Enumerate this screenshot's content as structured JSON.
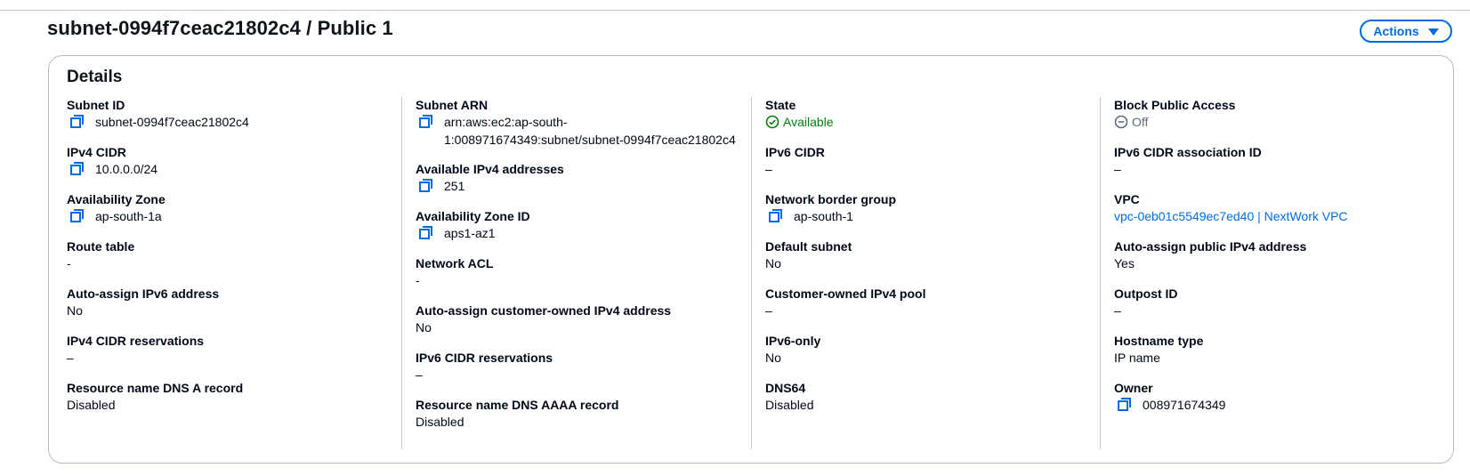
{
  "header": {
    "title": "subnet-0994f7ceac21802c4 / Public 1",
    "actions_label": "Actions"
  },
  "details": {
    "title": "Details",
    "columns": [
      [
        {
          "label": "Subnet ID",
          "value": "subnet-0994f7ceac21802c4",
          "copy": true
        },
        {
          "label": "IPv4 CIDR",
          "value": "10.0.0.0/24",
          "copy": true
        },
        {
          "label": "Availability Zone",
          "value": "ap-south-1a",
          "copy": true
        },
        {
          "label": "Route table",
          "value": "-"
        },
        {
          "label": "Auto-assign IPv6 address",
          "value": "No"
        },
        {
          "label": "IPv4 CIDR reservations",
          "value": "–"
        },
        {
          "label": "Resource name DNS A record",
          "value": "Disabled"
        }
      ],
      [
        {
          "label": "Subnet ARN",
          "value": "arn:aws:ec2:ap-south-\n1:008971674349:subnet/subnet-0994f7ceac21802c4",
          "copy": true
        },
        {
          "label": "Available IPv4 addresses",
          "value": "251",
          "copy": true
        },
        {
          "label": "Availability Zone ID",
          "value": "aps1-az1",
          "copy": true
        },
        {
          "label": "Network ACL",
          "value": "-"
        },
        {
          "label": "Auto-assign customer-owned IPv4 address",
          "value": "No"
        },
        {
          "label": "IPv6 CIDR reservations",
          "value": "–"
        },
        {
          "label": "Resource name DNS AAAA record",
          "value": "Disabled"
        }
      ],
      [
        {
          "label": "State",
          "value": "Available",
          "status": "success"
        },
        {
          "label": "IPv6 CIDR",
          "value": "–"
        },
        {
          "label": "Network border group",
          "value": "ap-south-1",
          "copy": true
        },
        {
          "label": "Default subnet",
          "value": "No"
        },
        {
          "label": "Customer-owned IPv4 pool",
          "value": "–"
        },
        {
          "label": "IPv6-only",
          "value": "No"
        },
        {
          "label": "DNS64",
          "value": "Disabled"
        }
      ],
      [
        {
          "label": "Block Public Access",
          "value": "Off",
          "status": "off"
        },
        {
          "label": "IPv6 CIDR association ID",
          "value": "–"
        },
        {
          "label": "VPC",
          "value": "vpc-0eb01c5549ec7ed40 | NextWork VPC",
          "link": true
        },
        {
          "label": "Auto-assign public IPv4 address",
          "value": "Yes"
        },
        {
          "label": "Outpost ID",
          "value": "–"
        },
        {
          "label": "Hostname type",
          "value": "IP name"
        },
        {
          "label": "Owner",
          "value": "008971674349",
          "copy": true
        }
      ]
    ]
  },
  "colors": {
    "link": "#006ce0",
    "success": "#037f0c",
    "muted": "#5f6b7a",
    "text": "#000716"
  },
  "icons": {
    "copy": "copy-icon",
    "success": "status-positive-icon",
    "off": "status-stopped-icon",
    "actions_caret": "caret-down-icon"
  }
}
